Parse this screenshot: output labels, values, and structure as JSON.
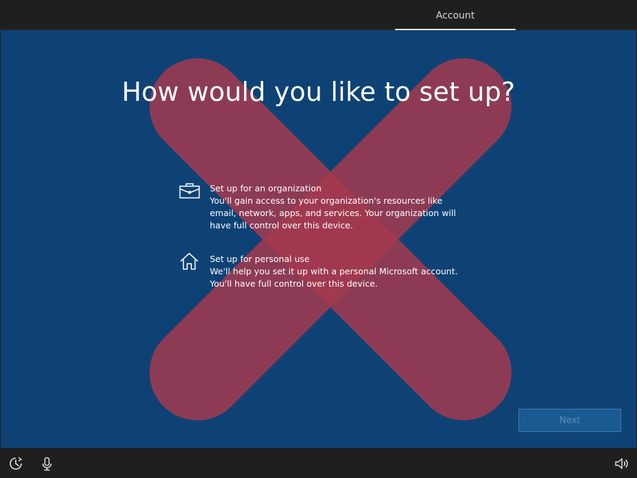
{
  "top_bar": {
    "tabs": [
      {
        "label": "Account",
        "active": true
      }
    ]
  },
  "main": {
    "title": "How would you like to set up?",
    "options": [
      {
        "icon": "briefcase-icon",
        "title": "Set up for an organization",
        "description": "You'll gain access to your organization's resources like email, network, apps, and services. Your organization will have full control over this device."
      },
      {
        "icon": "home-icon",
        "title": "Set up for personal use",
        "description": "We'll help you set it up with a personal Microsoft account. You'll have full control over this device."
      }
    ],
    "next_label": "Next",
    "next_enabled": false
  },
  "bottom_bar": {
    "icons": [
      "ease-of-access-icon",
      "microphone-icon",
      "volume-icon"
    ]
  },
  "colors": {
    "background": "#0e4275",
    "chrome": "#1f1f1f",
    "overlay_x": "#a33a4f"
  }
}
